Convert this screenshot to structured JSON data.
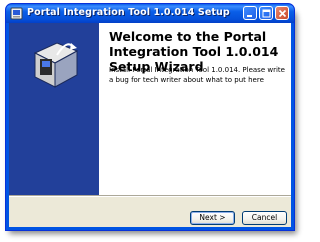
{
  "window": {
    "title": "Portal Integration Tool 1.0.014 Setup",
    "controls": [
      "minimize-icon",
      "maximize-icon",
      "close-icon"
    ]
  },
  "welcome": {
    "heading": "Welcome to the Portal Integration Tool 1.0.014 Setup Wizard",
    "description": "Install Portal Integration Tool 1.0.014. Please write a bug for tech writer about what to put here"
  },
  "buttons": {
    "next_label": "Next >",
    "cancel_label": "Cancel"
  },
  "colors": {
    "titlebar": "#0a5fe8",
    "banner": "#22409a",
    "dialog_bg": "#ece9d8"
  }
}
